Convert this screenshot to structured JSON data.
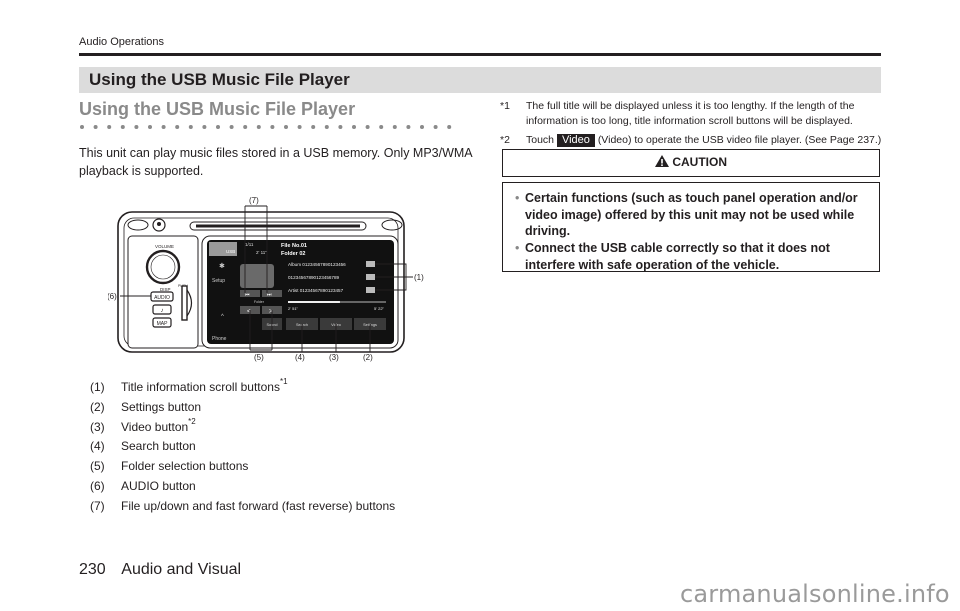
{
  "running_head": "Audio Operations",
  "section_title": "Using the USB Music File Player",
  "subheading": "Using the USB Music File Player",
  "intro": "This unit can play music files stored in a USB memory. Only MP3/WMA playback is supported.",
  "figure": {
    "callouts": [
      "(1)",
      "(2)",
      "(3)",
      "(4)",
      "(5)",
      "(6)",
      "(7)"
    ],
    "screen": {
      "source_label": "USB",
      "track_count": "1/11",
      "elapsed_small": "2' 11\"",
      "file_no": "File No.01",
      "folder": "Folder 02",
      "album": "Album 01234567890123456",
      "title": "01234567890123456789",
      "artist": "Artist 01234567890123457",
      "time_elapsed": "2' 51\"",
      "time_total": "5' 22\"",
      "progress": 0.53,
      "folder_label": "Folder",
      "side_items": [
        "Setup",
        "Phone"
      ],
      "buttons": [
        "Sound",
        "Search",
        "Video",
        "Settings"
      ],
      "hw_labels": {
        "volume": "VOLUME",
        "push": "PUSH",
        "disp": "DISP",
        "audio": "AUDIO",
        "phone": "♪",
        "map": "MAP"
      }
    }
  },
  "legend": [
    {
      "num": "(1)",
      "text": "Title information scroll buttons",
      "sup": "*1"
    },
    {
      "num": "(2)",
      "text": "Settings button",
      "sup": ""
    },
    {
      "num": "(3)",
      "text": "Video button",
      "sup": "*2"
    },
    {
      "num": "(4)",
      "text": "Search button",
      "sup": ""
    },
    {
      "num": "(5)",
      "text": "Folder selection buttons",
      "sup": ""
    },
    {
      "num": "(6)",
      "text": "AUDIO button",
      "sup": ""
    },
    {
      "num": "(7)",
      "text": "File up/down and fast forward (fast reverse) buttons",
      "sup": ""
    }
  ],
  "notes": {
    "n1_mark": "*1",
    "n1_text": "The full title will be displayed unless it is too lengthy. If the length of the information is too long, title information scroll buttons will be displayed.",
    "n2_mark": "*2",
    "n2_pre": "Touch",
    "n2_chip": "Video",
    "n2_post": "(Video) to operate the USB video file player. (See Page 237.)"
  },
  "caution": {
    "title": "CAUTION",
    "items": [
      "Certain functions (such as touch panel operation and/or video image) offered by this unit may not be used while driving.",
      "Connect the USB cable correctly so that it does not interfere with safe operation of the vehicle."
    ]
  },
  "footer": {
    "page": "230",
    "section": "Audio and Visual"
  },
  "watermark": "carmanualsonline.info"
}
